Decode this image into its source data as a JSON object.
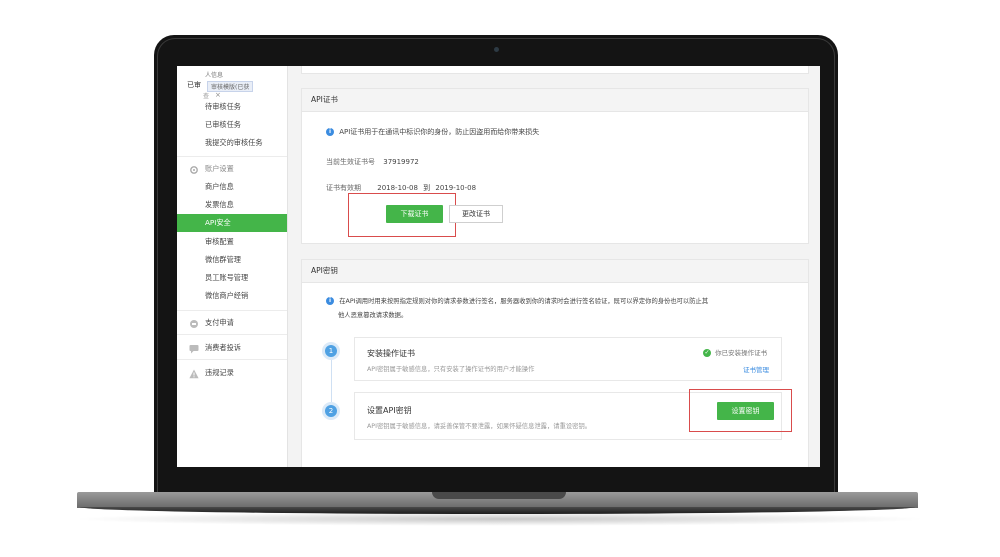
{
  "sidebar": {
    "top_fragments": [
      "人信息",
      "已审",
      "审核模版(已获",
      "查",
      "×"
    ],
    "items_top": [
      "待审核任务",
      "已审核任务",
      "我提交的审核任务"
    ],
    "account_group": "账户设置",
    "account_items": [
      "商户信息",
      "发票信息",
      "API安全",
      "审核配置",
      "微信群管理",
      "员工账号管理",
      "微信商户经销"
    ],
    "active_item": "API安全",
    "group_payment": "支付申请",
    "group_complaint": "消费者投诉",
    "group_violation": "违规记录"
  },
  "cert_panel": {
    "title": "API证书",
    "notice": "API证书用于在通讯中标识你的身份，防止因盗用而给你带来损失",
    "serial_label": "当前生效证书号",
    "serial_value": "37919972",
    "validity_label": "证书有效期",
    "validity_start": "2018-10-08",
    "validity_to": "到",
    "validity_end": "2019-10-08",
    "download_button": "下载证书",
    "change_button": "更改证书"
  },
  "key_panel": {
    "title": "API密钥",
    "notice_line1": "在API调用时用来按照指定规则对你的请求参数进行签名，服务器收到你的请求时会进行签名验证，既可以界定你的身份也可以防止其",
    "notice_line2": "他人恶意篡改请求数据。",
    "step1": {
      "number": "1",
      "title": "安装操作证书",
      "desc": "API密钥属于敏感信息，只有安装了操作证书的用户才能操作",
      "status": "你已安装操作证书",
      "link": "证书管理"
    },
    "step2": {
      "number": "2",
      "title": "设置API密钥",
      "desc": "API密钥属于敏感信息，请妥善保管不要泄露，如果怀疑信息泄露，请重设密钥。",
      "button": "设置密钥"
    }
  },
  "colors": {
    "accent_green": "#44b549",
    "info_blue": "#3b8ce0",
    "highlight_red": "#d94c4c"
  }
}
